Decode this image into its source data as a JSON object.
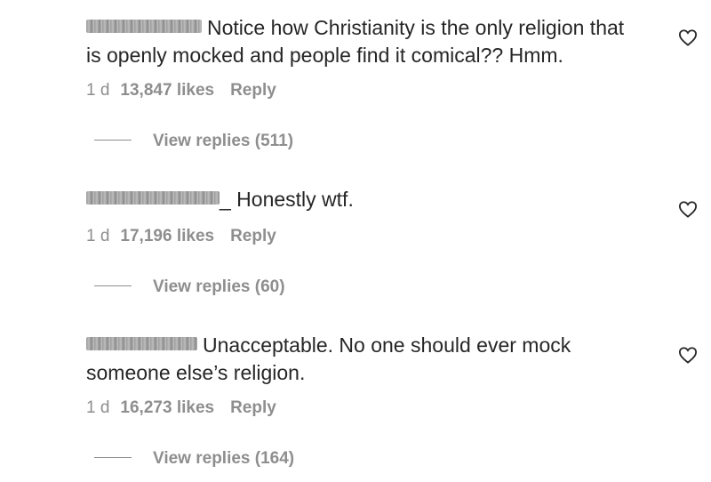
{
  "comments": [
    {
      "text_line1": "Notice how Christianity is the only religion that",
      "text_line2": "is openly mocked and people find it comical?? Hmm.",
      "time": "1 d",
      "likes": "13,847 likes",
      "reply": "Reply",
      "view_replies": "View replies (511)",
      "icon": "heart-outline-icon"
    },
    {
      "text_line1": "_ Honestly wtf.",
      "time": "1 d",
      "likes": "17,196 likes",
      "reply": "Reply",
      "view_replies": "View replies (60)",
      "icon": "heart-outline-icon"
    },
    {
      "text_line1": "Unacceptable. No one should ever mock",
      "text_line2": "someone else’s religion.",
      "time": "1 d",
      "likes": "16,273 likes",
      "reply": "Reply",
      "view_replies": "View replies (164)",
      "icon": "heart-outline-icon"
    }
  ]
}
